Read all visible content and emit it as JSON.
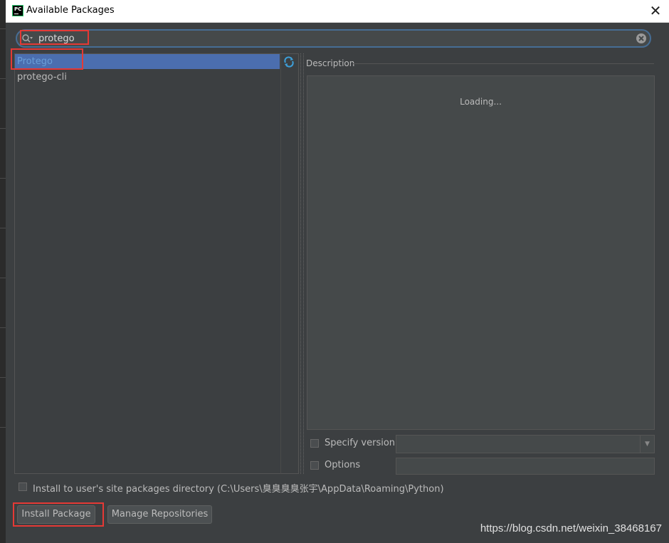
{
  "window": {
    "title": "Available Packages",
    "close_glyph": "✕"
  },
  "search": {
    "value": "protego",
    "placeholder": ""
  },
  "packages": [
    {
      "name": "Protego",
      "selected": true
    },
    {
      "name": "protego-cli",
      "selected": false
    }
  ],
  "description": {
    "label": "Description",
    "status": "Loading..."
  },
  "specify_version": {
    "label": "Specify version",
    "checked": false,
    "selected_value": ""
  },
  "options": {
    "label": "Options",
    "checked": false,
    "value": ""
  },
  "install_to_user": {
    "label": "Install to user's site packages directory (C:\\Users\\臭臭臭臭张宇\\AppData\\Roaming\\Python)",
    "checked": false
  },
  "buttons": {
    "install": "Install Package",
    "manage": "Manage Repositories"
  },
  "watermark": "https://blog.csdn.net/weixin_38468167",
  "colors": {
    "accent": "#4b6eaf",
    "highlight": "#e53935",
    "background": "#3c3f41"
  },
  "icons": [
    "pycharm-icon",
    "close-icon",
    "search-icon",
    "clear-icon",
    "refresh-icon",
    "chevron-down-icon"
  ]
}
